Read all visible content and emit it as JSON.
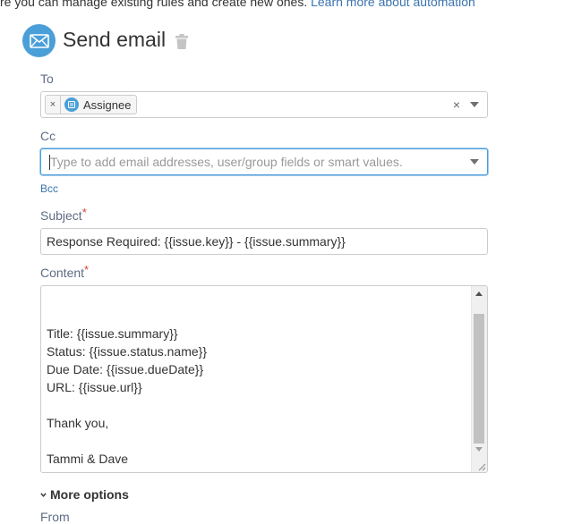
{
  "top_text": {
    "prefix": "re you can manage existing rules and create new ones.",
    "link": "Learn more about automation"
  },
  "header": {
    "title": "Send email"
  },
  "to": {
    "label": "To",
    "tags": [
      {
        "label": "Assignee"
      }
    ],
    "clear_symbol": "×",
    "remove_symbol": "×"
  },
  "cc": {
    "label": "Cc",
    "placeholder": "Type to add email addresses, user/group fields or smart values."
  },
  "bcc": {
    "label": "Bcc"
  },
  "subject": {
    "label": "Subject",
    "required_mark": "*",
    "value": "Response Required: {{issue.key}} - {{issue.summary}}"
  },
  "content": {
    "label": "Content",
    "required_mark": "*",
    "lines": [
      "",
      "",
      "Title: {{issue.summary}}",
      "Status: {{issue.status.name}}",
      "Due Date: {{issue.dueDate}}",
      "URL: {{issue.url}}",
      "",
      "Thank you,",
      "",
      "Tammi & Dave"
    ]
  },
  "more_options": {
    "label": "More options"
  },
  "from": {
    "label": "From"
  },
  "colors": {
    "accent": "#4a9fd8",
    "link": "#3b73af",
    "required": "#d04437"
  },
  "icons": [
    "envelope-icon",
    "trash-icon",
    "user-group-icon",
    "chevron-down-icon",
    "dropdown-caret-icon"
  ]
}
